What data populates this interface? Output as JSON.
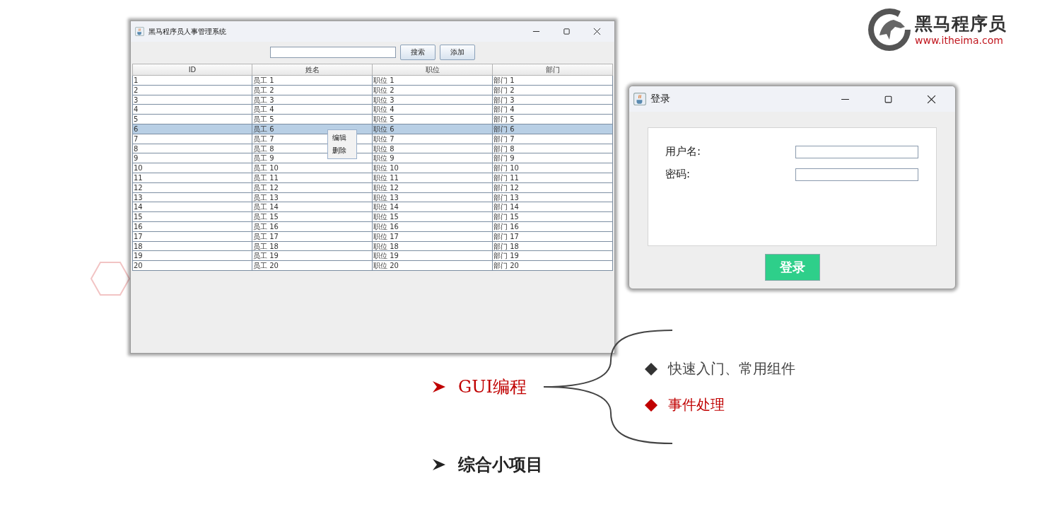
{
  "logo": {
    "name": "黑马程序员",
    "url": "www.itheima.com"
  },
  "main_window": {
    "title": "黑马程序员人事管理系统",
    "buttons": [
      "搜索",
      "添加"
    ],
    "table": {
      "columns": [
        "ID",
        "姓名",
        "职位",
        "部门"
      ],
      "rows": [
        {
          "cells": [
            "1",
            "员工 1",
            "职位 1",
            "部门 1"
          ],
          "selected": false
        },
        {
          "cells": [
            "2",
            "员工 2",
            "职位 2",
            "部门 2"
          ],
          "selected": false
        },
        {
          "cells": [
            "3",
            "员工 3",
            "职位 3",
            "部门 3"
          ],
          "selected": false
        },
        {
          "cells": [
            "4",
            "员工 4",
            "职位 4",
            "部门 4"
          ],
          "selected": false
        },
        {
          "cells": [
            "5",
            "员工 5",
            "职位 5",
            "部门 5"
          ],
          "selected": false
        },
        {
          "cells": [
            "6",
            "员工 6",
            "职位 6",
            "部门 6"
          ],
          "selected": true
        },
        {
          "cells": [
            "7",
            "员工 7",
            "职位 7",
            "部门 7"
          ],
          "selected": false
        },
        {
          "cells": [
            "8",
            "员工 8",
            "职位 8",
            "部门 8"
          ],
          "selected": false
        },
        {
          "cells": [
            "9",
            "员工 9",
            "职位 9",
            "部门 9"
          ],
          "selected": false
        },
        {
          "cells": [
            "10",
            "员工 10",
            "职位 10",
            "部门 10"
          ],
          "selected": false
        },
        {
          "cells": [
            "11",
            "员工 11",
            "职位 11",
            "部门 11"
          ],
          "selected": false
        },
        {
          "cells": [
            "12",
            "员工 12",
            "职位 12",
            "部门 12"
          ],
          "selected": false
        },
        {
          "cells": [
            "13",
            "员工 13",
            "职位 13",
            "部门 13"
          ],
          "selected": false
        },
        {
          "cells": [
            "14",
            "员工 14",
            "职位 14",
            "部门 14"
          ],
          "selected": false
        },
        {
          "cells": [
            "15",
            "员工 15",
            "职位 15",
            "部门 15"
          ],
          "selected": false
        },
        {
          "cells": [
            "16",
            "员工 16",
            "职位 16",
            "部门 16"
          ],
          "selected": false
        },
        {
          "cells": [
            "17",
            "员工 17",
            "职位 17",
            "部门 17"
          ],
          "selected": false
        },
        {
          "cells": [
            "18",
            "员工 18",
            "职位 18",
            "部门 18"
          ],
          "selected": false
        },
        {
          "cells": [
            "19",
            "员工 19",
            "职位 19",
            "部门 19"
          ],
          "selected": false
        },
        {
          "cells": [
            "20",
            "员工 20",
            "职位 20",
            "部门 20"
          ],
          "selected": false
        }
      ]
    },
    "context_menu": [
      "编辑",
      "删除"
    ]
  },
  "login_window": {
    "title": "登录",
    "fields": [
      {
        "label": "用户名:"
      },
      {
        "label": "密码:"
      }
    ],
    "button": "登录"
  },
  "outline": [
    {
      "text": "GUI编程",
      "active": true,
      "children": [
        {
          "text": "快速入门、常用组件",
          "active": false
        },
        {
          "text": "事件处理",
          "active": true
        }
      ]
    },
    {
      "text": "综合小项目",
      "active": false
    }
  ]
}
